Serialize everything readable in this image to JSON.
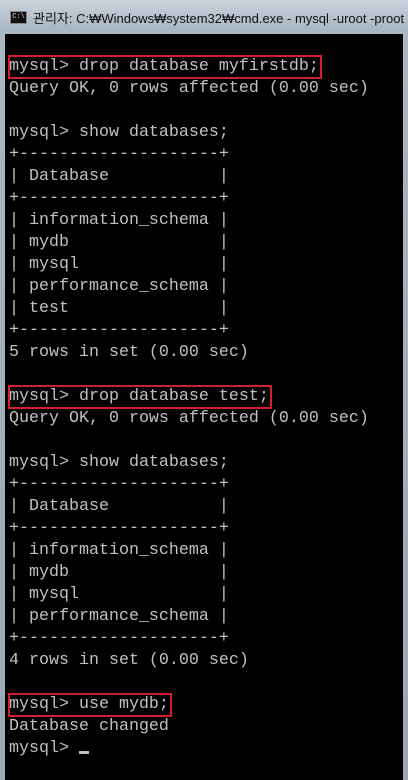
{
  "window": {
    "title": "관리자: C:₩Windows₩system32₩cmd.exe - mysql  -uroot -proot",
    "icon": "cmd-icon"
  },
  "terminal": {
    "lines": [
      "mysql> drop database myfirstdb;",
      "Query OK, 0 rows affected (0.00 sec)",
      "",
      "mysql> show databases;",
      "+--------------------+",
      "| Database           |",
      "+--------------------+",
      "| information_schema |",
      "| mydb               |",
      "| mysql              |",
      "| performance_schema |",
      "| test               |",
      "+--------------------+",
      "5 rows in set (0.00 sec)",
      "",
      "mysql> drop database test;",
      "Query OK, 0 rows affected (0.00 sec)",
      "",
      "mysql> show databases;",
      "+--------------------+",
      "| Database           |",
      "+--------------------+",
      "| information_schema |",
      "| mydb               |",
      "| mysql              |",
      "| performance_schema |",
      "+--------------------+",
      "4 rows in set (0.00 sec)",
      "",
      "mysql> use mydb;",
      "Database changed",
      "mysql> "
    ],
    "highlighted": [
      0,
      15,
      29
    ],
    "highlight_color": "#d0202a"
  }
}
